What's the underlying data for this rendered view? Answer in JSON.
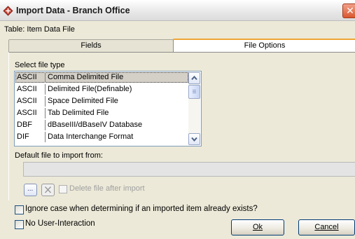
{
  "window": {
    "title": "Import Data - Branch Office",
    "close_glyph": "✕"
  },
  "table_label": "Table:  Item Data File",
  "tabs": [
    {
      "label": "Fields"
    },
    {
      "label": "File Options"
    }
  ],
  "file_options": {
    "select_label": "Select file type",
    "file_types": [
      {
        "code": "ASCII",
        "desc": "Comma Delimited File"
      },
      {
        "code": "ASCII",
        "desc": "Delimited File(Definable)"
      },
      {
        "code": "ASCII",
        "desc": "Space Delimited File"
      },
      {
        "code": "ASCII",
        "desc": "Tab Delimited File"
      },
      {
        "code": "DBF",
        "desc": "dBaseIII/dBaseIV Database"
      },
      {
        "code": "DIF",
        "desc": "Data Interchange Format"
      }
    ],
    "selected_index": 0,
    "default_file_label": "Default file to import from:",
    "default_file_value": "",
    "browse_label": "...",
    "delete_after_import_label": "Delete file after import"
  },
  "options": {
    "ignore_case_label": "Ignore case when determining if an imported item already exists?",
    "no_user_interaction_label": "No User-Interaction"
  },
  "buttons": {
    "ok": "Ok",
    "cancel": "Cancel"
  },
  "colors": {
    "tab_accent": "#f0a535",
    "close_button": "#d9572e",
    "dialog_bg": "#ECE9D8"
  }
}
